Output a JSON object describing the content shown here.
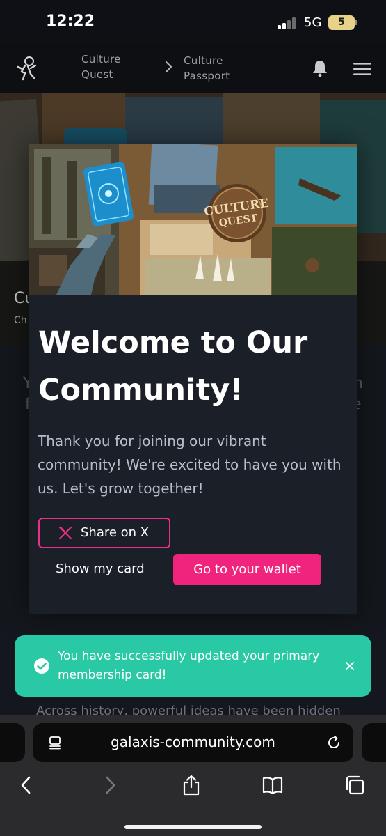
{
  "status_bar": {
    "time": "12:22",
    "network": "5G",
    "battery": "5"
  },
  "header": {
    "breadcrumb": [
      "Culture Quest",
      "Culture Passport"
    ]
  },
  "background_page": {
    "hero_title_fragment": "Cu",
    "hero_subtitle_fragment": "Ch",
    "left_fragment_1": "Y",
    "left_fragment_2": "f",
    "right_fragment_1": "n",
    "right_fragment_2": "e",
    "body_text": "Across history, powerful ideas have been hidden"
  },
  "modal": {
    "banner_logo_text": "CULTURE QUEST",
    "title": "Welcome to Our Community!",
    "text": "Thank you for joining our vibrant community! We're excited to have you with us. Let's grow together!",
    "share_label": "Share on X",
    "show_card_label": "Show my card",
    "wallet_label": "Go to your wallet"
  },
  "toast": {
    "message": "You have successfully updated your primary membership card!"
  },
  "browser": {
    "url": "galaxis-community.com"
  },
  "colors": {
    "accent": "#f0247c",
    "toast": "#28c9a4",
    "modal_bg": "#1b1f28"
  }
}
